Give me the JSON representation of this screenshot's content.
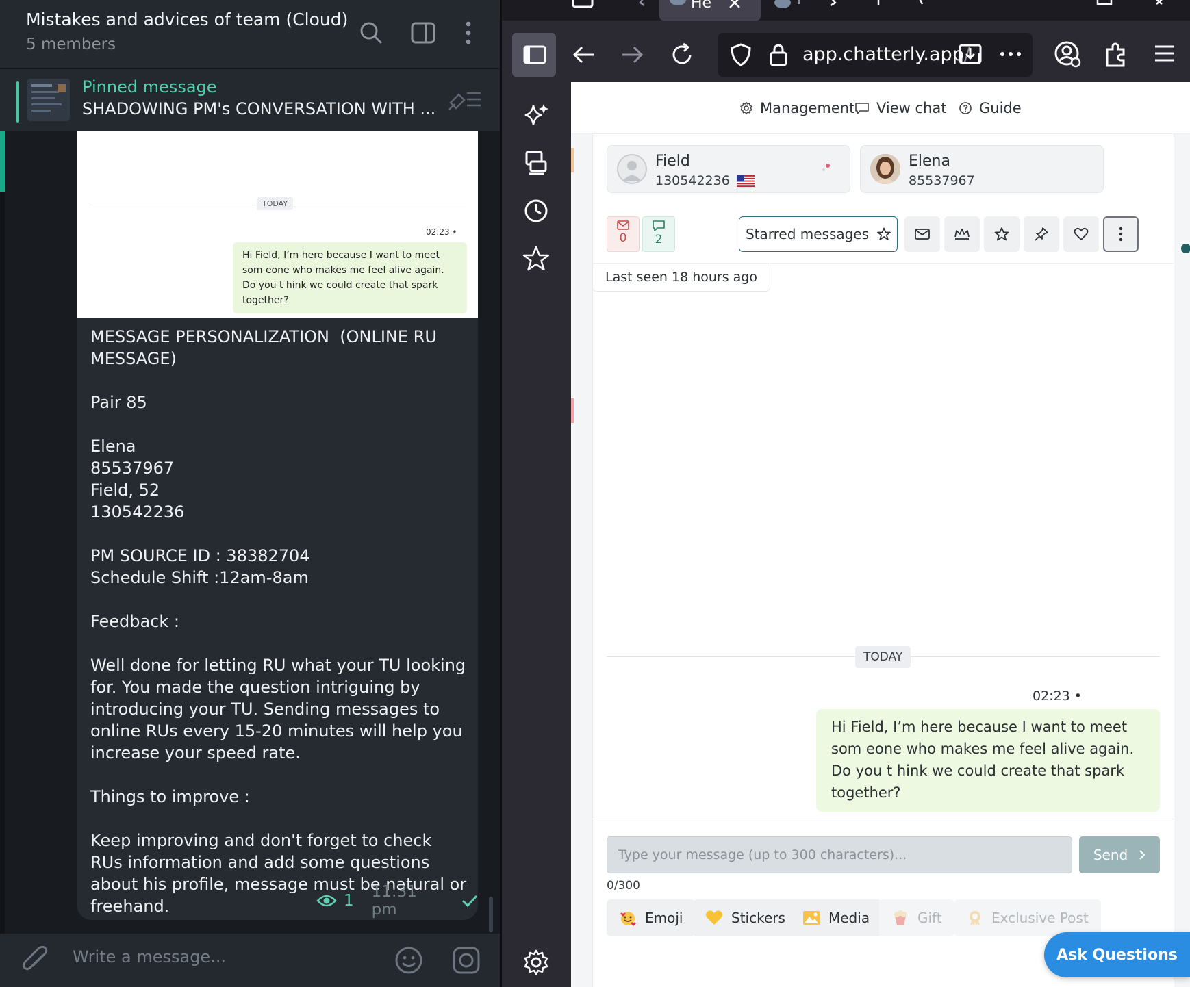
{
  "telegram": {
    "title": "Mistakes and advices of team (Cloud)",
    "members": "5 members",
    "pinned_label": "Pinned message",
    "pinned_text": "SHADOWING PM's CONVERSATION WITH ...",
    "screenshot": {
      "today": "TODAY",
      "time": "02:23 •",
      "message": "Hi Field, I’m here because I want to meet som eone who makes me feel alive again. Do you t hink we could create that spark together?"
    },
    "message_text": "MESSAGE PERSONALIZATION  (ONLINE RU MESSAGE)\n\nPair 85\n\nElena\n85537967\nField, 52\n130542236\n\nPM SOURCE ID : 38382704\nSchedule Shift :12am-8am\n\nFeedback :\n\nWell done for letting RU what your TU looking for. You made the question intriguing by introducing your TU. Sending messages to online RUs every 15-20 minutes will help you increase your speed rate.\n\nThings to improve :\n\nKeep improving and don't forget to check RUs information and add some questions about his profile, message must be natural or freehand.",
    "views": "1",
    "time": "11:31 pm",
    "compose_placeholder": "Write a message..."
  },
  "browser": {
    "tab_label": "He",
    "url_domain": "app.chatterly.app",
    "url_rest": "/",
    "menu": {
      "management": "Management",
      "view_chat": "View chat",
      "guide": "Guide"
    },
    "profiles": [
      {
        "name": "Field",
        "id": "130542236"
      },
      {
        "name": "Elena",
        "id": "85537967"
      }
    ],
    "counters": {
      "mail": "0",
      "chat": "2"
    },
    "starred_label": "Starred messages",
    "last_seen": "Last seen 18 hours ago",
    "chat": {
      "today": "TODAY",
      "time": "02:23 •",
      "message": "Hi Field, I’m here because I want to meet som eone who makes me feel alive again. Do you t hink we could create that spark together?"
    },
    "compose": {
      "placeholder": "Type your message (up to 300 characters)...",
      "count": "0/300",
      "send": "Send"
    },
    "media_buttons": {
      "emoji": "Emoji",
      "stickers": "Stickers",
      "media": "Media",
      "gift": "Gift",
      "exclusive": "Exclusive Post"
    },
    "ask_questions": "Ask Questions"
  },
  "colors": {
    "telegram_accent": "#4fd2ab",
    "firefox_bg": "#2b2a33",
    "teal_border": "#2c6e7f",
    "ask_button": "#2a8de2",
    "message_bubble": "#eef9e2"
  }
}
